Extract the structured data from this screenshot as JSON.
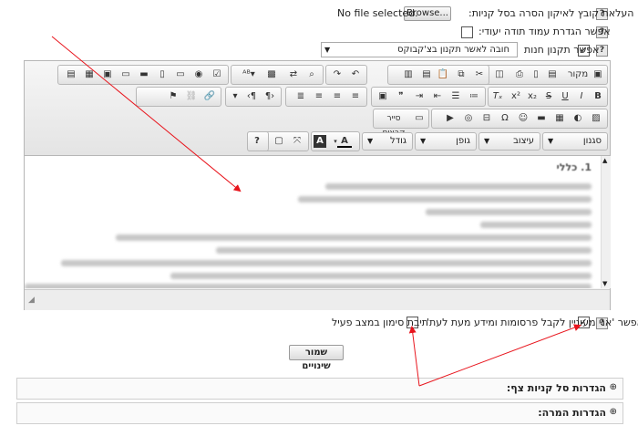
{
  "upload": {
    "label": "העלאת קובץ לאיקון הסרה בסל קניות:",
    "browse_label": "Browse...",
    "file_status": "No file selected."
  },
  "custom_thankyou": {
    "label": "אפשר הגדרת עמוד תודה יעודי:",
    "checked": false
  },
  "terms": {
    "label": "אפשר תקנון חנות",
    "checked": true,
    "select_value": "חובה לאשר תקנון בצ'קבוקס"
  },
  "editor": {
    "source_label": "מקור",
    "file_manager_label": "סייר קבצים",
    "combos": {
      "styles": "סגנון",
      "format": "עיצוב",
      "font": "גופן",
      "size": "גודל"
    },
    "content_heading": "1. כללי",
    "resize_icon": "resize-grip-icon"
  },
  "newsletter": {
    "label": "אפשר 'אני מעוניין לקבל פרסומות ומידע מעת לעת'",
    "checked": true
  },
  "active_marker": {
    "label": "תיבת סימון במצב פעיל",
    "checked": false
  },
  "save_button": "שמור שינויים",
  "sections": [
    {
      "title": "הגדרות סל קניות צף:",
      "icon": "⊕"
    },
    {
      "title": "הגדרות המרה:",
      "icon": "⊕"
    }
  ],
  "annotation_color": "#e8141c",
  "help_glyph": "?"
}
